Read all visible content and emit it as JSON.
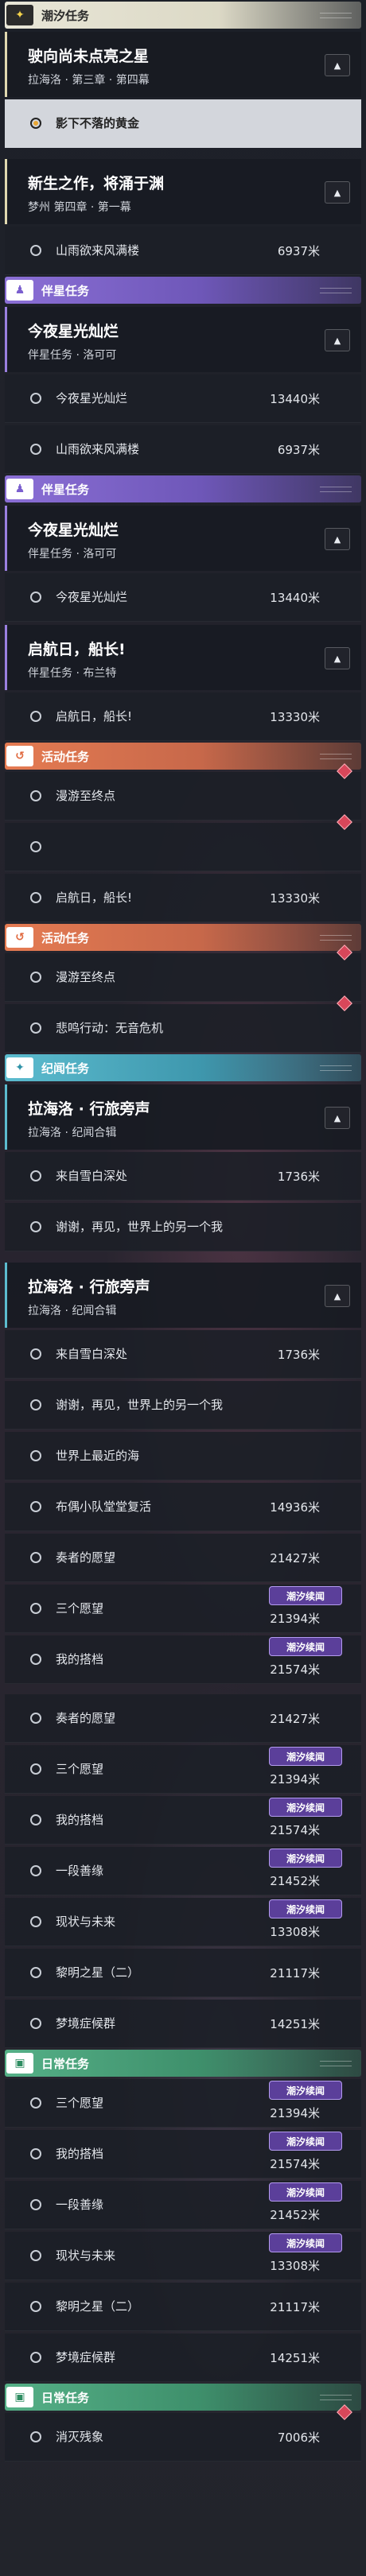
{
  "colors": {
    "tidal": "#dcd9c6",
    "companion": "#8b6fd6",
    "event": "#e57b52",
    "journal": "#5cbccf",
    "daily": "#55b087",
    "tidal_badge": "#5b3f9a",
    "warning": "#d8475a"
  },
  "tidal_badge_label": "潮汐续闻",
  "list": [
    {
      "t": "cat",
      "kind": "tidal",
      "icon": "✦",
      "label": "潮汐任务",
      "icon_name": "sparkle-icon"
    },
    {
      "t": "mission",
      "kind": "tidal",
      "title": "驶向尚未点亮之星",
      "sub": "拉海洛 · 第三章 · 第四幕"
    },
    {
      "t": "obj",
      "label": "影下不落的黄金",
      "active": true
    },
    {
      "t": "gap"
    },
    {
      "t": "mission",
      "kind": "tidal",
      "title": "新生之作，将涌于渊",
      "sub": "梦州 第四章 · 第一幕"
    },
    {
      "t": "obj",
      "label": "山雨欲来风满楼",
      "dist": "6937米"
    },
    {
      "t": "cat",
      "kind": "companion",
      "icon": "♟",
      "label": "伴星任务",
      "icon_name": "companion-icon"
    },
    {
      "t": "mission",
      "kind": "comp",
      "title": "今夜星光灿烂",
      "sub": "伴星任务 · 洛可可"
    },
    {
      "t": "obj",
      "label": "今夜星光灿烂",
      "dist": "13440米"
    },
    {
      "t": "obj",
      "label": "山雨欲来风满楼",
      "dist": "6937米",
      "clip": true
    },
    {
      "t": "cat",
      "kind": "companion",
      "icon": "♟",
      "label": "伴星任务",
      "icon_name": "companion-icon"
    },
    {
      "t": "mission",
      "kind": "comp",
      "title": "今夜星光灿烂",
      "sub": "伴星任务 · 洛可可"
    },
    {
      "t": "obj",
      "label": "今夜星光灿烂",
      "dist": "13440米"
    },
    {
      "t": "mission",
      "kind": "comp",
      "title": "启航日，船长!",
      "sub": "伴星任务 · 布兰特"
    },
    {
      "t": "obj",
      "label": "启航日，船长!",
      "dist": "13330米"
    },
    {
      "t": "cat",
      "kind": "event",
      "icon": "↺",
      "label": "活动任务",
      "icon_name": "event-icon"
    },
    {
      "t": "obj",
      "label": "漫游至终点",
      "warn": true
    },
    {
      "t": "obj",
      "label": "",
      "warn": true
    },
    {
      "t": "obj",
      "label": "启航日，船长!",
      "dist": "13330米"
    },
    {
      "t": "cat",
      "kind": "event",
      "icon": "↺",
      "label": "活动任务",
      "icon_name": "event-icon"
    },
    {
      "t": "obj",
      "label": "漫游至终点",
      "warn": true
    },
    {
      "t": "obj",
      "label": "悲鸣行动：无音危机",
      "warn": true
    },
    {
      "t": "cat",
      "kind": "journal",
      "icon": "✦",
      "label": "纪闻任务",
      "icon_name": "journal-icon"
    },
    {
      "t": "mission",
      "kind": "journal",
      "title": "拉海洛 · 行旅旁声",
      "sub": "拉海洛 · 纪闻合辑"
    },
    {
      "t": "obj",
      "label": "来自雪白深处",
      "dist": "1736米"
    },
    {
      "t": "obj",
      "label": "谢谢，再见，世界上的另一个我"
    },
    {
      "t": "gap"
    },
    {
      "t": "mission",
      "kind": "journal",
      "title": "拉海洛 · 行旅旁声",
      "sub": "拉海洛 · 纪闻合辑"
    },
    {
      "t": "obj",
      "label": "来自雪白深处",
      "dist": "1736米"
    },
    {
      "t": "obj",
      "label": "谢谢，再见，世界上的另一个我"
    },
    {
      "t": "obj",
      "label": "世界上最近的海"
    },
    {
      "t": "obj",
      "label": "布偶小队堂堂复活",
      "dist": "14936米"
    },
    {
      "t": "obj",
      "label": "奏者的愿望",
      "dist": "21427米"
    },
    {
      "t": "obj",
      "label": "三个愿望",
      "dist": "21394米",
      "badge": true
    },
    {
      "t": "obj",
      "label": "我的搭档",
      "dist": "21574米",
      "badge": true
    },
    {
      "t": "gap"
    },
    {
      "t": "obj",
      "label": "奏者的愿望",
      "dist": "21427米"
    },
    {
      "t": "obj",
      "label": "三个愿望",
      "dist": "21394米",
      "badge": true
    },
    {
      "t": "obj",
      "label": "我的搭档",
      "dist": "21574米",
      "badge": true
    },
    {
      "t": "obj",
      "label": "一段善缘",
      "dist": "21452米",
      "badge": true
    },
    {
      "t": "obj",
      "label": "现状与未来",
      "dist": "13308米",
      "badge": true
    },
    {
      "t": "obj",
      "label": "黎明之星（二）",
      "dist": "21117米"
    },
    {
      "t": "obj",
      "label": "梦境症候群",
      "dist": "14251米"
    },
    {
      "t": "cat",
      "kind": "daily",
      "icon": "▣",
      "label": "日常任务",
      "icon_name": "daily-icon"
    },
    {
      "t": "obj",
      "label": "三个愿望",
      "dist": "21394米",
      "badge": true
    },
    {
      "t": "obj",
      "label": "我的搭档",
      "dist": "21574米",
      "badge": true
    },
    {
      "t": "obj",
      "label": "一段善缘",
      "dist": "21452米",
      "badge": true
    },
    {
      "t": "obj",
      "label": "现状与未来",
      "dist": "13308米",
      "badge": true
    },
    {
      "t": "obj",
      "label": "黎明之星（二）",
      "dist": "21117米"
    },
    {
      "t": "obj",
      "label": "梦境症候群",
      "dist": "14251米"
    },
    {
      "t": "cat",
      "kind": "daily",
      "icon": "▣",
      "label": "日常任务",
      "icon_name": "daily-icon"
    },
    {
      "t": "obj",
      "label": "消灭残象",
      "dist": "7006米",
      "warn": true
    }
  ]
}
